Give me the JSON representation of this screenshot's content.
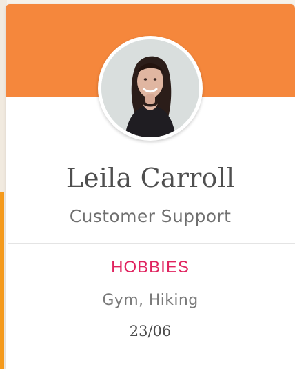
{
  "profile": {
    "name": "Leila Carroll",
    "role": "Customer Support",
    "section_label": "HOBBIES",
    "hobbies": "Gym, Hiking",
    "date": "23/06"
  },
  "colors": {
    "header": "#f5873c",
    "accent": "#e0235f",
    "backdrop_accent": "#f59a1b"
  },
  "icons": {
    "avatar": "person-photo"
  }
}
